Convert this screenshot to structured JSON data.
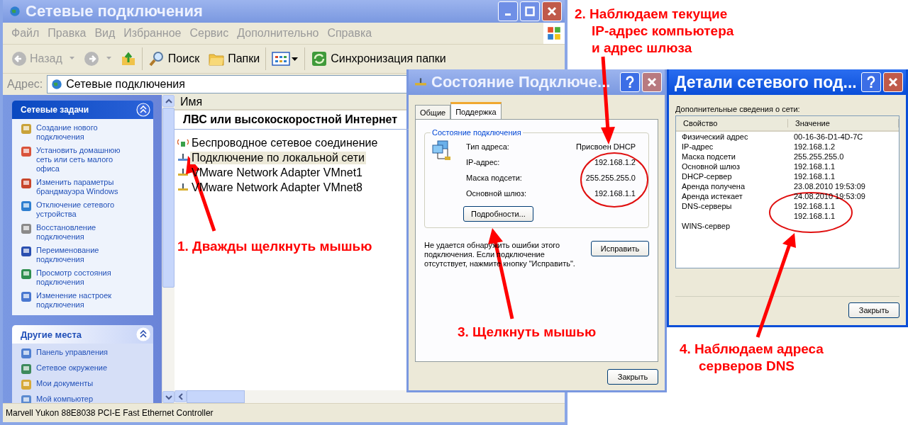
{
  "explorer": {
    "title": "Сетевые подключения",
    "menu": [
      "Файл",
      "Правка",
      "Вид",
      "Избранное",
      "Сервис",
      "Дополнительно",
      "Справка"
    ],
    "toolbar": [
      {
        "kind": "back",
        "label": "Назад",
        "disabled": true
      },
      {
        "kind": "forward",
        "disabled": true
      },
      {
        "kind": "up"
      },
      {
        "kind": "search",
        "label": "Поиск"
      },
      {
        "kind": "folders",
        "label": "Папки"
      },
      {
        "kind": "views"
      },
      {
        "kind": "sync",
        "label": "Синхронизация папки"
      }
    ],
    "address_label": "Адрес:",
    "address": "Сетевые подключения",
    "panels": [
      {
        "title": "Сетевые задачи",
        "dark": true,
        "items": [
          "Создание нового подключения",
          "Установить домашнюю сеть или сеть малого офиса",
          "Изменить параметры брандмауэра Windows",
          "Отключение сетевого устройства",
          "Восстановление подключения",
          "Переименование подключения",
          "Просмотр состояния подключения",
          "Изменение настроек подключения"
        ]
      },
      {
        "title": "Другие места",
        "dark": false,
        "items": [
          "Панель управления",
          "Сетевое окружение",
          "Мои документы",
          "Мой компьютер"
        ]
      }
    ],
    "column": "Имя",
    "group": "ЛВС или высокоскоростной Интернет",
    "connections": [
      {
        "label": "Беспроводное сетевое соединение",
        "kind": "wireless",
        "selected": false
      },
      {
        "label": "Подключение по локальной сети",
        "kind": "wired",
        "selected": true
      },
      {
        "label": "VMware Network Adapter VMnet1",
        "kind": "virtual",
        "selected": false
      },
      {
        "label": "VMware Network Adapter VMnet8",
        "kind": "virtual",
        "selected": false
      }
    ],
    "status_bar": "Marvell Yukon 88E8038 PCI-E Fast Ethernet Controller"
  },
  "status_dialog": {
    "title": "Состояние Подключе...",
    "tabs": [
      {
        "label": "Общие",
        "selected": false
      },
      {
        "label": "Поддержка",
        "selected": true
      }
    ],
    "group_title": "Состояние подключения",
    "fields": [
      {
        "label": "Тип адреса:",
        "value": "Присвоен DHCP"
      },
      {
        "label": "IP-адрес:",
        "value": "192.168.1.2"
      },
      {
        "label": "Маска подсети:",
        "value": "255.255.255.0"
      },
      {
        "label": "Основной шлюз:",
        "value": "192.168.1.1"
      }
    ],
    "details_button": "Подробности...",
    "message": "Не удается обнаружить ошибки этого подключения. Если подключение отсутствует, нажмите кнопку \"Исправить\".",
    "repair_button": "Исправить",
    "close_button": "Закрыть"
  },
  "details_dialog": {
    "title": "Детали сетевого под...",
    "caption": "Дополнительные сведения о сети:",
    "columns": [
      "Свойство",
      "Значение"
    ],
    "rows": [
      {
        "property": "Физический адрес",
        "value": "00-16-36-D1-4D-7C"
      },
      {
        "property": "IP-адрес",
        "value": "192.168.1.2"
      },
      {
        "property": "Маска подсети",
        "value": "255.255.255.0"
      },
      {
        "property": "Основной шлюз",
        "value": "192.168.1.1"
      },
      {
        "property": "DHCP-сервер",
        "value": "192.168.1.1"
      },
      {
        "property": "Аренда получена",
        "value": "23.08.2010 19:53:09"
      },
      {
        "property": "Аренда истекает",
        "value": "24.08.2010 19:53:09"
      },
      {
        "property": "DNS-серверы",
        "value": "192.168.1.1"
      },
      {
        "value": "192.168.1.1"
      },
      {
        "property": "WINS-сервер"
      }
    ],
    "close_button": "Закрыть"
  },
  "annotations": [
    {
      "lines": [
        "1. Дважды щелкнуть мышью"
      ]
    },
    {
      "lines": [
        "2. Наблюдаем текущие",
        "IP-адрес компьютера",
        "и адрес шлюза"
      ]
    },
    {
      "lines": [
        "3. Щелкнуть мышью"
      ]
    },
    {
      "lines": [
        "4. Наблюдаем адреса",
        "серверов DNS"
      ]
    }
  ]
}
